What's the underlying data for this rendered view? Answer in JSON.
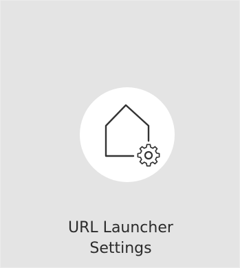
{
  "tile": {
    "icon": "home-settings-icon",
    "label_line1": "URL Launcher",
    "label_line2": "Settings"
  },
  "colors": {
    "tile_background": "#e4e4e4",
    "icon_circle": "#ffffff",
    "icon_stroke": "#333333",
    "label_text": "#2b2b2b"
  }
}
